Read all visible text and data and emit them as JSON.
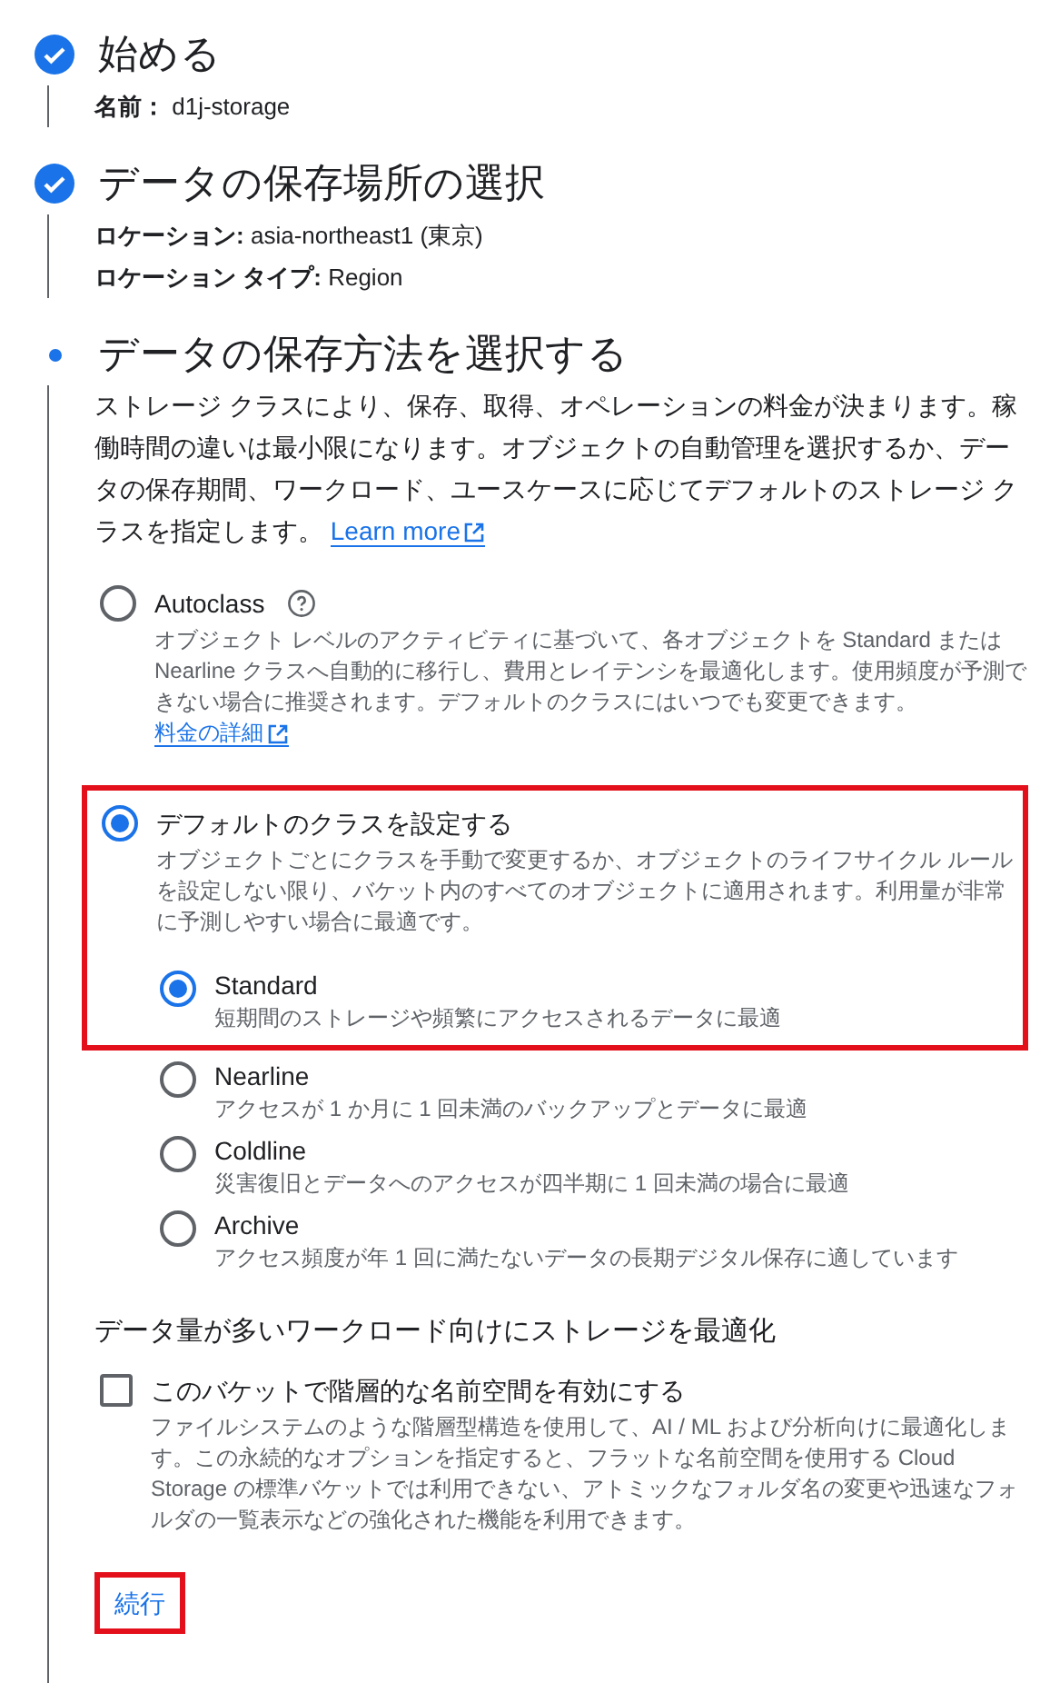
{
  "steps": [
    {
      "title": "始める",
      "kind": "done",
      "details": [
        {
          "label": "名前：",
          "value": "d1j-storage"
        }
      ]
    },
    {
      "title": "データの保存場所の選択",
      "kind": "done",
      "details": [
        {
          "label": "ロケーション:",
          "value": "asia-northeast1 (東京)"
        },
        {
          "label": "ロケーション タイプ:",
          "value": "Region"
        }
      ]
    },
    {
      "title": "データの保存方法を選択する",
      "kind": "current",
      "intro": "ストレージ クラスにより、保存、取得、オペレーションの料金が決まります。稼働時間の違いは最小限になります。オブジェクトの自動管理を選択するか、データの保存期間、ワークロード、ユースケースに応じてデフォルトのストレージ クラスを指定します。",
      "intro_link": "Learn more",
      "options": [
        {
          "label": "Autoclass",
          "help": true,
          "selected": false,
          "highlighted": false,
          "description": "オブジェクト レベルのアクティビティに基づいて、各オブジェクトを Standard または Nearline クラスへ自動的に移行し、費用とレイテンシを最適化します。使用頻度が予測できない場合に推奨されます。デフォルトのクラスにはいつでも変更できます。",
          "link": "料金の詳細"
        },
        {
          "label": "デフォルトのクラスを設定する",
          "selected": true,
          "highlighted": true,
          "description": "オブジェクトごとにクラスを手動で変更するか、オブジェクトのライフサイクル ルールを設定しない限り、バケット内のすべてのオブジェクトに適用されます。利用量が非常に予測しやすい場合に最適です。",
          "sub_options": [
            {
              "label": "Standard",
              "description": "短期間のストレージや頻繁にアクセスされるデータに最適",
              "selected": true,
              "highlighted": true
            },
            {
              "label": "Nearline",
              "description": "アクセスが 1 か月に 1 回未満のバックアップとデータに最適",
              "selected": false,
              "highlighted": false
            },
            {
              "label": "Coldline",
              "description": "災害復旧とデータへのアクセスが四半期に 1 回未満の場合に最適",
              "selected": false,
              "highlighted": false
            },
            {
              "label": "Archive",
              "description": "アクセス頻度が年 1 回に満たないデータの長期デジタル保存に適しています",
              "selected": false,
              "highlighted": false
            }
          ]
        }
      ],
      "optimize": {
        "heading": "データ量が多いワークロード向けにストレージを最適化",
        "checkbox": {
          "label": "このバケットで階層的な名前空間を有効にする",
          "checked": false,
          "description": "ファイルシステムのような階層型構造を使用して、AI / ML および分析向けに最適化します。この永続的なオプションを指定すると、フラットな名前空間を使用する Cloud Storage の標準バケットでは利用できない、アトミックなフォルダ名の変更や迅速なフォルダの一覧表示などの強化された機能を利用できます。"
        }
      },
      "continue_button": {
        "label": "続行",
        "highlighted": true
      }
    }
  ]
}
